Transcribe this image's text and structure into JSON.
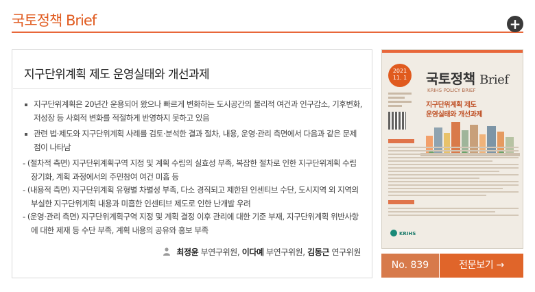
{
  "header": {
    "title": "국토정책 Brief",
    "more_icon": "plus-icon"
  },
  "article": {
    "title": "지구단위계획 제도 운영실태와 개선과제",
    "bullets": [
      "지구단위계획은 20년간 운용되어 왔으나 빠르게 변화하는 도시공간의 물리적 여건과 인구감소, 기후변화, 저성장 등 사회적 변화를 적절하게 반영하지 못하고 있음",
      "관련 법·제도와 지구단위계획 사례를 검토·분석한 결과 절차, 내용, 운영·관리 측면에서 다음과 같은 문제점이 나타남"
    ],
    "dashes": [
      "- (절차적 측면) 지구단위계획구역 지정 및 계획 수립의 실효성 부족, 복잡한 절차로 인한 지구단위계획 수립 장기화, 계획 과정에서의 주민참여 여건 미흡 등",
      "- (내용적 측면) 지구단위계획 유형별 차별성 부족, 다소 경직되고 제한된 인센티브 수단, 도시지역 외 지역의 부실한 지구단위계획 내용과 미흡한 인센티브 제도로 인한 난개발 우려",
      "- (운영·관리 측면) 지구단위계획구역 지정 및 계획 결정 이후 관리에 대한 기준 부재, 지구단위계획 위반사항에 대한 제재 등 수단 부족, 계획 내용의 공유와 홍보 부족"
    ],
    "authors": [
      {
        "name": "최정윤",
        "role": "부연구위원"
      },
      {
        "name": "이다예",
        "role": "부연구위원"
      },
      {
        "name": "김동근",
        "role": "연구위원"
      }
    ],
    "author_sep": ", "
  },
  "cover": {
    "badge_year": "2021",
    "badge_date": "11. 1",
    "brand_ko": "국토정책",
    "brand_en": "Brief",
    "subtitle": "KRIHS POLICY BRIEF",
    "title_line1": "지구단위계획 제도",
    "title_line2": "운영실태와 개선과제",
    "publisher": "KRIHS"
  },
  "footer": {
    "issue_no": "No. 839",
    "full_view_label": "전문보기 →"
  },
  "colors": {
    "accent": "#e05a1e",
    "accent_soft": "#d77a4b",
    "rule": "#e8673a"
  }
}
